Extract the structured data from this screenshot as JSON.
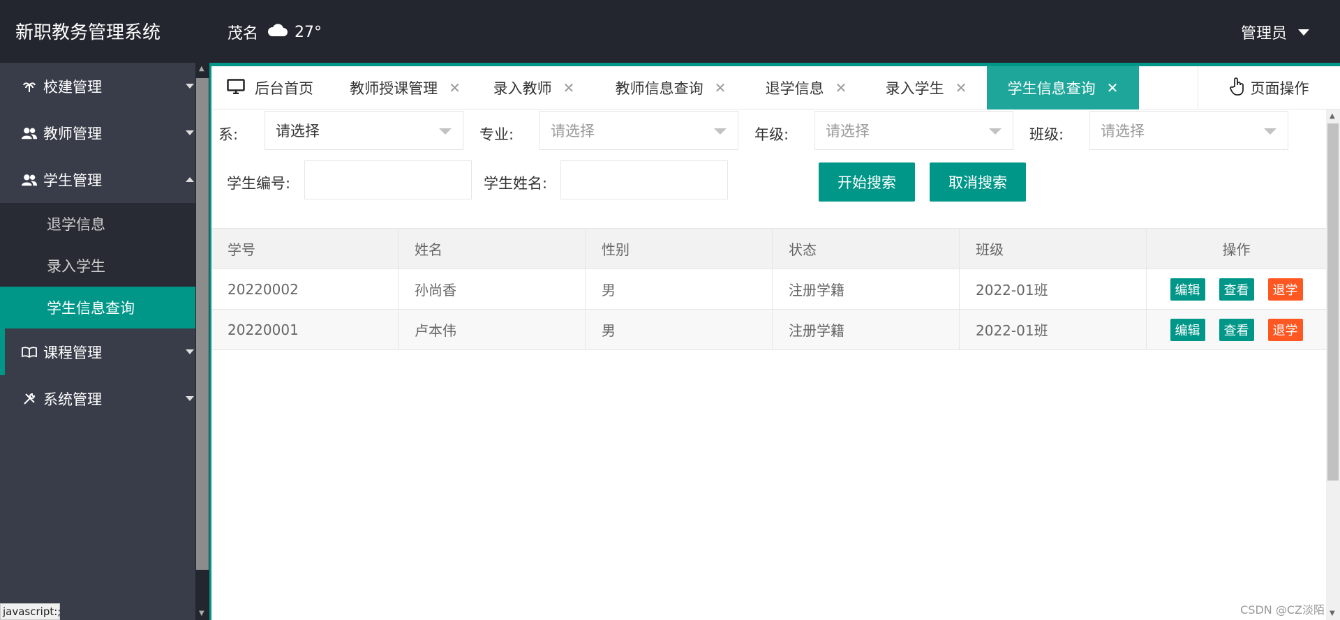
{
  "header": {
    "app_title": "新职教务管理系统",
    "weather_city": "茂名",
    "weather_temp": "27°",
    "user": "管理员"
  },
  "sidebar": {
    "items": [
      {
        "label": "校建管理",
        "icon": "palm-tree-icon"
      },
      {
        "label": "教师管理",
        "icon": "users-icon"
      },
      {
        "label": "学生管理",
        "icon": "users-icon",
        "expanded": true,
        "children": [
          {
            "label": "退学信息"
          },
          {
            "label": "录入学生"
          },
          {
            "label": "学生信息查询",
            "active": true
          }
        ]
      },
      {
        "label": "课程管理",
        "icon": "book-icon"
      },
      {
        "label": "系统管理",
        "icon": "tools-icon"
      }
    ]
  },
  "status_tip": "javascript:;",
  "tabs": {
    "home": "后台首页",
    "items": [
      {
        "label": "教师授课管理"
      },
      {
        "label": "录入教师"
      },
      {
        "label": "教师信息查询"
      },
      {
        "label": "退学信息"
      },
      {
        "label": "录入学生"
      },
      {
        "label": "学生信息查询",
        "active": true
      }
    ],
    "page_ops": "页面操作"
  },
  "filters": {
    "dept_label": "系:",
    "dept_value": "请选择",
    "major_label": "专业:",
    "major_placeholder": "请选择",
    "grade_label": "年级:",
    "grade_placeholder": "请选择",
    "class_label": "班级:",
    "class_placeholder": "请选择",
    "student_no_label": "学生编号:",
    "student_name_label": "学生姓名:",
    "search_button": "开始搜索",
    "cancel_button": "取消搜索"
  },
  "table": {
    "headers": [
      "学号",
      "姓名",
      "性别",
      "状态",
      "班级",
      "操作"
    ],
    "rows": [
      {
        "id": "20220002",
        "name": "孙尚香",
        "gender": "男",
        "status": "注册学籍",
        "class": "2022-01班"
      },
      {
        "id": "20220001",
        "name": "卢本伟",
        "gender": "男",
        "status": "注册学籍",
        "class": "2022-01班"
      }
    ],
    "actions": {
      "edit": "编辑",
      "view": "查看",
      "drop": "退学"
    }
  },
  "watermark": "CSDN @CZ淡陌",
  "colors": {
    "accent": "#009688",
    "danger": "#ff5722",
    "header_bg": "#23262e",
    "sidebar_bg": "#393d49"
  }
}
